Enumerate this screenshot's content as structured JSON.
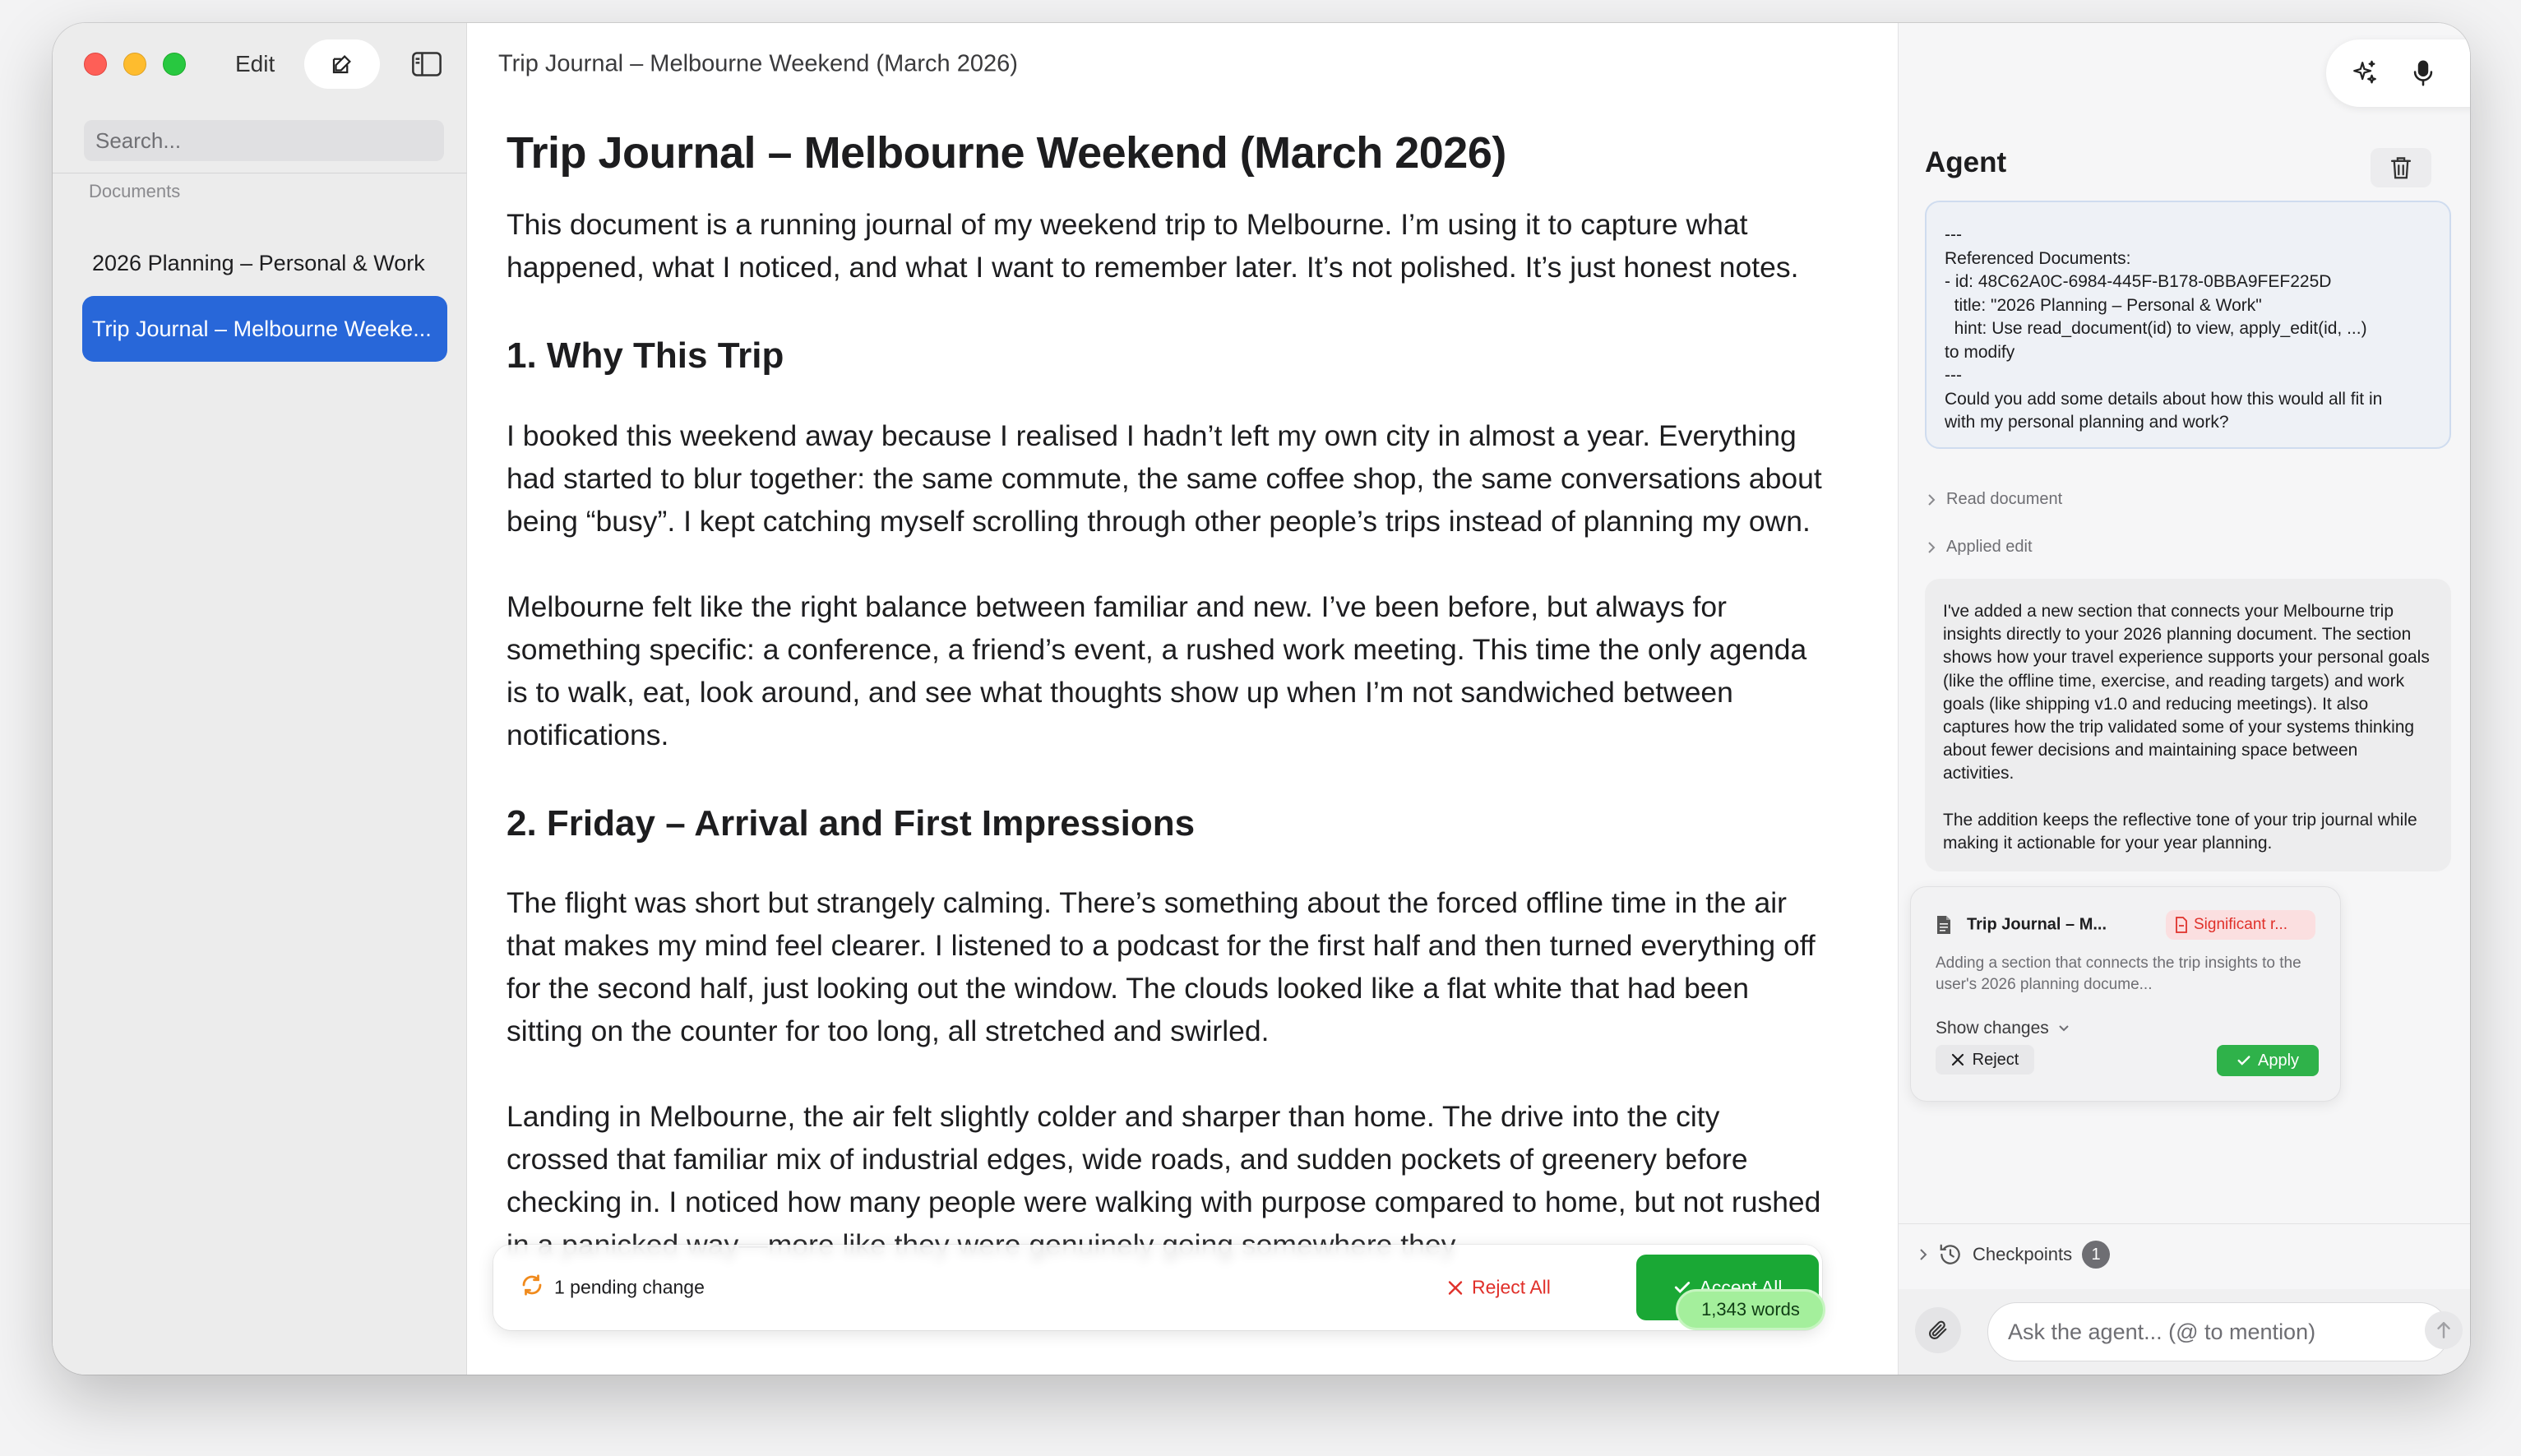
{
  "sidebar": {
    "edit_label": "Edit",
    "search_placeholder": "Search...",
    "section_label": "Documents",
    "items": [
      {
        "label": "2026 Planning – Personal & Work"
      },
      {
        "label": "Trip Journal – Melbourne Weeke..."
      }
    ],
    "icons": [
      "compose-icon",
      "sidebar-toggle-icon"
    ]
  },
  "main": {
    "window_title": "Trip Journal – Melbourne Weekend (March 2026)",
    "doc_title": "Trip Journal – Melbourne Weekend (March 2026)",
    "intro": "This document is a running journal of my weekend trip to Melbourne. I’m using it to capture what happened, what I noticed, and what I want to remember later. It’s not polished. It’s just honest notes.",
    "section1_heading": "1. Why This Trip",
    "section1_p1": "I booked this weekend away because I realised I hadn’t left my own city in almost a year. Everything had started to blur together: the same commute, the same coffee shop, the same conversations about being “busy”. I kept catching myself scrolling through other people’s trips instead of planning my own.",
    "section1_p2": "Melbourne felt like the right balance between familiar and new. I’ve been before, but always for something specific: a conference, a friend’s event, a rushed work meeting. This time the only agenda is to walk, eat, look around, and see what thoughts show up when I’m not sandwiched between notifications.",
    "section2_heading": "2. Friday – Arrival and First Impressions",
    "section2_p1": "The flight was short but strangely calming. There’s something about the forced offline time in the air that makes my mind feel clearer. I listened to a podcast for the first half and then turned everything off for the second half, just looking out the window. The clouds looked like a flat white that had been sitting on the counter for too long, all stretched and swirled.",
    "section2_p2": "Landing in Melbourne, the air felt slightly colder and sharper than home. The drive into the city crossed that familiar mix of industrial edges, wide roads, and sudden pockets of greenery before checking in. I noticed how many people were walking with purpose compared to home, but not rushed in a panicked way—more like they were genuinely going somewhere they"
  },
  "pending": {
    "text": "1 pending change",
    "reject_all": "Reject All",
    "accept_all": "Accept All",
    "word_count": "1,343 words"
  },
  "agent": {
    "title": "Agent",
    "user_message": "---\nReferenced Documents:\n- id: 48C62A0C-6984-445F-B178-0BBA9FEF225D\n  title: \"2026 Planning – Personal & Work\"\n  hint: Use read_document(id) to view, apply_edit(id, ...)\nto modify\n---\nCould you add some details about how this would all fit in\nwith my personal planning and work?",
    "tool_read": "Read document",
    "tool_applied": "Applied edit",
    "assistant_p1": "I've added a new section that connects your Melbourne trip insights directly to your 2026 planning document. The section shows how your travel experience supports your personal goals (like the offline time, exercise, and reading targets) and work goals (like shipping v1.0 and reducing meetings). It also captures how the trip validated some of your systems thinking about fewer decisions and maintaining space between activities.",
    "assistant_p2": "The addition keeps the reflective tone of your trip journal while making it actionable for your year planning.",
    "edit_card": {
      "title": "Trip Journal – M...",
      "badge": "Significant r...",
      "description": "Adding a section that connects the trip insights to the user's 2026 planning docume...",
      "show_changes": "Show changes",
      "reject": "Reject",
      "apply": "Apply"
    },
    "checkpoints_label": "Checkpoints",
    "checkpoints_count": "1",
    "input_placeholder": "Ask the agent... (@ to mention)"
  },
  "colors": {
    "accent_blue": "#2867d9",
    "accept_green": "#1aa835",
    "reject_red": "#e0302a"
  }
}
